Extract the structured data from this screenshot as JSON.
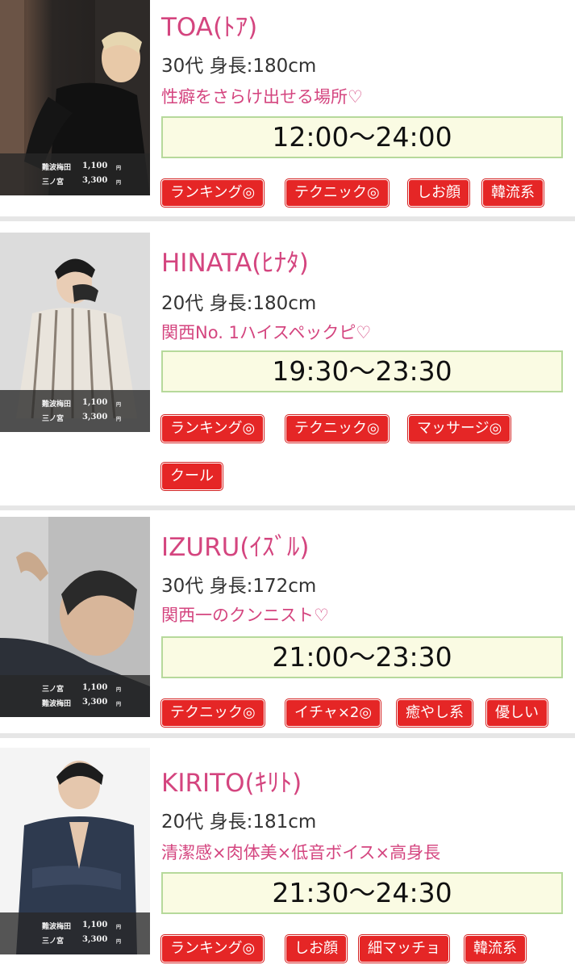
{
  "colors": {
    "name_pink": "#d4457f",
    "tag_red": "#e52626",
    "time_bg": "#fafbe3",
    "time_border": "#b6d99b"
  },
  "staff": [
    {
      "name": "TOA(ﾄｱ)",
      "spec": "30代 身長:180cm",
      "catch": "性癖をさらけ出せる場所♡",
      "time": "12:00〜24:00",
      "prices": [
        {
          "area": "難波梅田",
          "price": "1,100",
          "yen": "円"
        },
        {
          "area": "三ノ宮",
          "price": "3,300",
          "yen": "円"
        }
      ],
      "tags": [
        "ランキング◎",
        "テクニック◎",
        "しお顔",
        "韓流系"
      ]
    },
    {
      "name": "HINATA(ﾋﾅﾀ)",
      "spec": "20代 身長:180cm",
      "catch": "関西No. 1ハイスペックピ♡",
      "time": "19:30〜23:30",
      "prices": [
        {
          "area": "難波梅田",
          "price": "1,100",
          "yen": "円"
        },
        {
          "area": "三ノ宮",
          "price": "3,300",
          "yen": "円"
        }
      ],
      "tags": [
        "ランキング◎",
        "テクニック◎",
        "マッサージ◎",
        "クール"
      ]
    },
    {
      "name": "IZURU(ｲｽﾞﾙ)",
      "spec": "30代 身長:172cm",
      "catch": "関西一のクンニスト♡",
      "time": "21:00〜23:30",
      "prices": [
        {
          "area": "三ノ宮",
          "price": "1,100",
          "yen": "円"
        },
        {
          "area": "難波梅田",
          "price": "3,300",
          "yen": "円"
        }
      ],
      "tags": [
        "テクニック◎",
        "イチャ×2◎",
        "癒やし系",
        "優しい"
      ]
    },
    {
      "name": "KIRITO(ｷﾘﾄ)",
      "spec": "20代 身長:181cm",
      "catch": "清潔感×肉体美×低音ボイス×高身長",
      "time": "21:30〜24:30",
      "prices": [
        {
          "area": "難波梅田",
          "price": "1,100",
          "yen": "円"
        },
        {
          "area": "三ノ宮",
          "price": "3,300",
          "yen": "円"
        }
      ],
      "tags": [
        "ランキング◎",
        "しお顔",
        "細マッチョ",
        "韓流系"
      ]
    }
  ]
}
